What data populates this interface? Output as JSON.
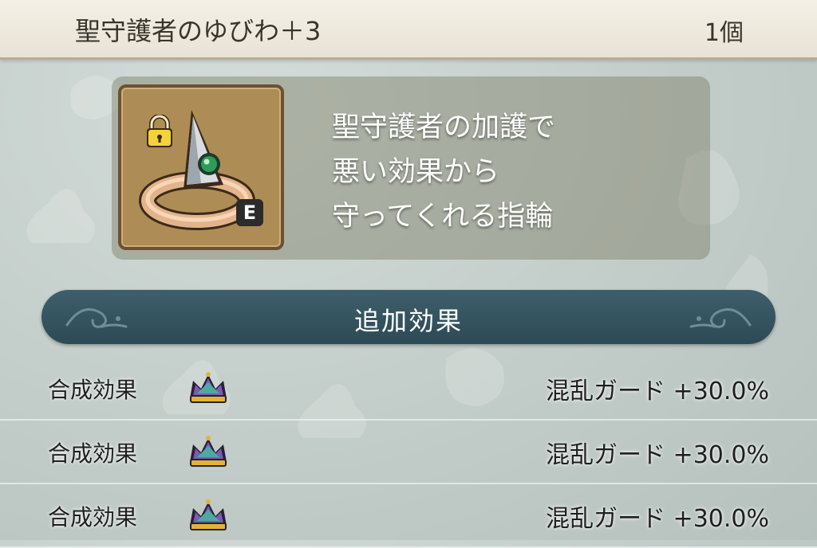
{
  "item": {
    "name": "聖守護者のゆびわ＋3",
    "count": "1個",
    "icon": "holy-guardian-ring-icon",
    "equip_badge": "E",
    "lock_icon": "lock-icon",
    "description_lines": [
      "聖守護者の加護で",
      "悪い効果から",
      "守ってくれる指輪"
    ]
  },
  "section": {
    "title": "追加効果"
  },
  "effects": [
    {
      "label": "合成効果",
      "icon": "crown-icon",
      "value": "混乱ガード +30.0%"
    },
    {
      "label": "合成効果",
      "icon": "crown-icon",
      "value": "混乱ガード +30.0%"
    },
    {
      "label": "合成効果",
      "icon": "crown-icon",
      "value": "混乱ガード +30.0%"
    }
  ],
  "colors": {
    "header_bg": "#efeadf",
    "section_bar": "#35545f",
    "panel_bg": "#8a8768",
    "icon_frame": "#ae8c55"
  }
}
